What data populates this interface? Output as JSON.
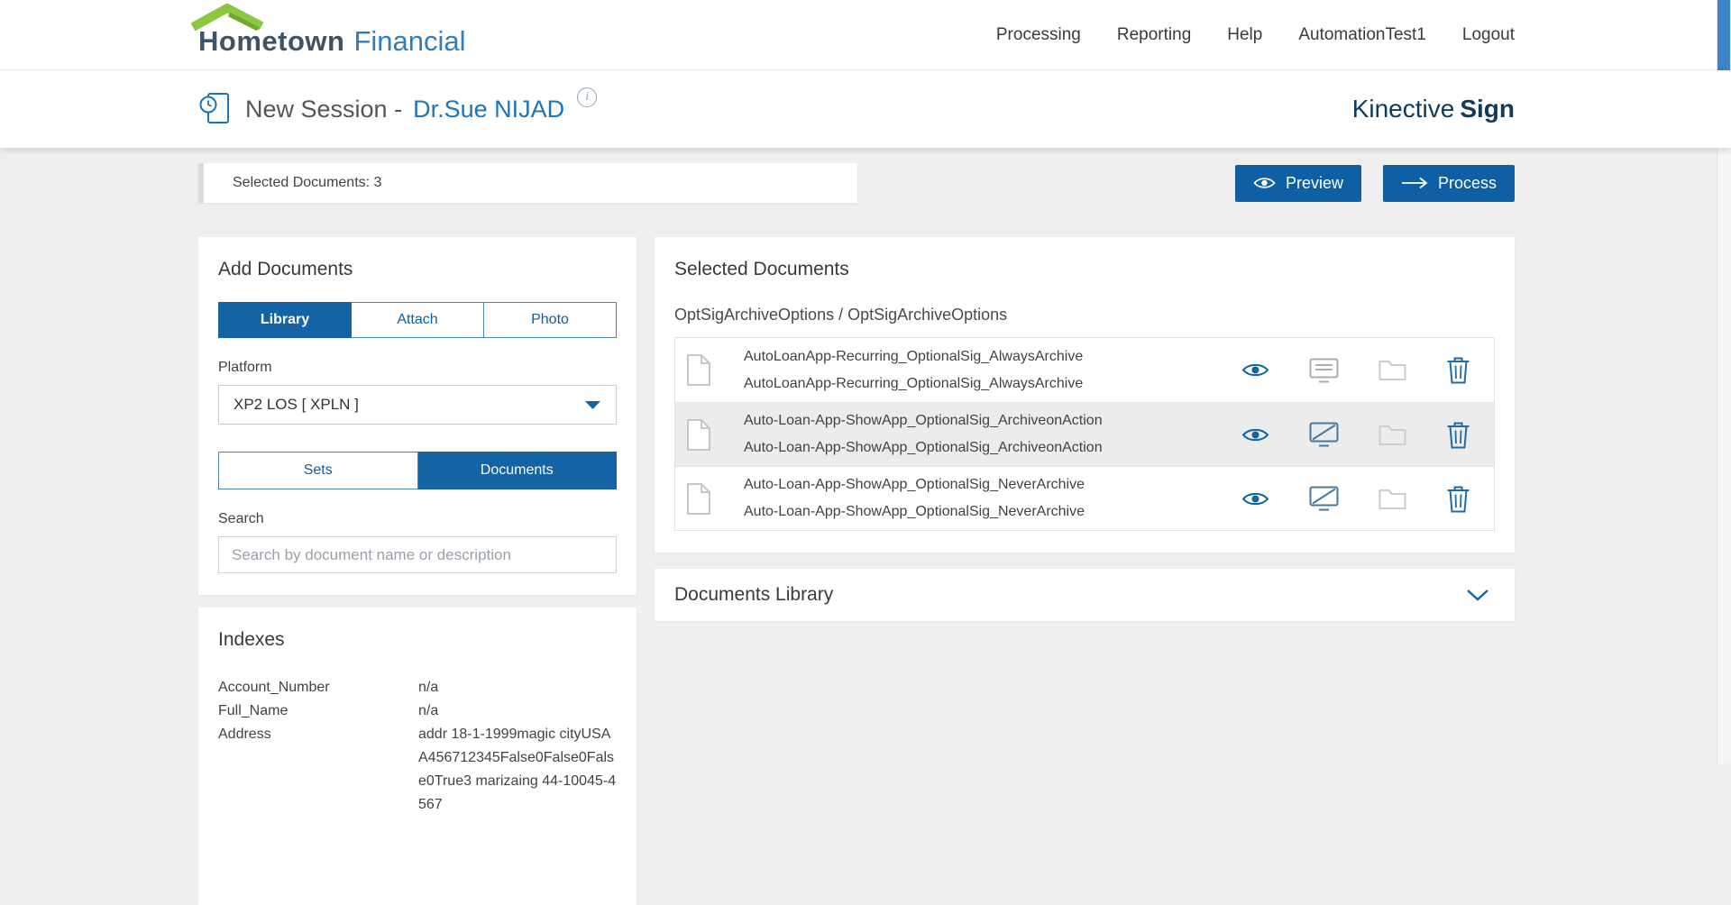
{
  "brand": {
    "name_primary": "Hometown",
    "name_secondary": "Financial"
  },
  "nav": {
    "items": [
      "Processing",
      "Reporting",
      "Help",
      "AutomationTest1",
      "Logout"
    ]
  },
  "session": {
    "title": "New Session -",
    "user": "Dr.Sue NIJAD",
    "info_icon": "i",
    "product": {
      "name": "Kinective",
      "suffix": "Sign"
    }
  },
  "toolbar": {
    "selected_count_label": "Selected Documents: 3",
    "preview_label": "Preview",
    "process_label": "Process"
  },
  "add_documents": {
    "title": "Add Documents",
    "tabs": [
      "Library",
      "Attach",
      "Photo"
    ],
    "active_tab": "Library",
    "platform_label": "Platform",
    "platform_value": "XP2 LOS [ XPLN ]",
    "view_toggle": [
      "Sets",
      "Documents"
    ],
    "active_view": "Documents",
    "search_label": "Search",
    "search_placeholder": "Search by document name or description",
    "search_value": ""
  },
  "indexes": {
    "title": "Indexes",
    "rows": [
      {
        "label": "Account_Number",
        "value": "n/a"
      },
      {
        "label": "Full_Name",
        "value": "n/a"
      },
      {
        "label": "Address",
        "value": "addr 18-1-1999magic cityUSAA456712345False0False0False0True3 marizaing 44-10045-4567"
      }
    ]
  },
  "selected_documents": {
    "title": "Selected Documents",
    "group_label": "OptSigArchiveOptions / OptSigArchiveOptions",
    "documents": [
      {
        "name": "AutoLoanApp-Recurring_OptionalSig_AlwaysArchive",
        "description": "AutoLoanApp-Recurring_OptionalSig_AlwaysArchive"
      },
      {
        "name": "Auto-Loan-App-ShowApp_OptionalSig_ArchiveonAction",
        "description": "Auto-Loan-App-ShowApp_OptionalSig_ArchiveonAction"
      },
      {
        "name": "Auto-Loan-App-ShowApp_OptionalSig_NeverArchive",
        "description": "Auto-Loan-App-ShowApp_OptionalSig_NeverArchive"
      }
    ]
  },
  "documents_library": {
    "title": "Documents Library"
  },
  "colors": {
    "primary": "#1464A5",
    "button_blue": "#0E5FA4",
    "link_blue": "#1B75BB",
    "navy": "#0E3A5C",
    "logo_green": "#8DC63F",
    "background": "#EFEFF0"
  }
}
